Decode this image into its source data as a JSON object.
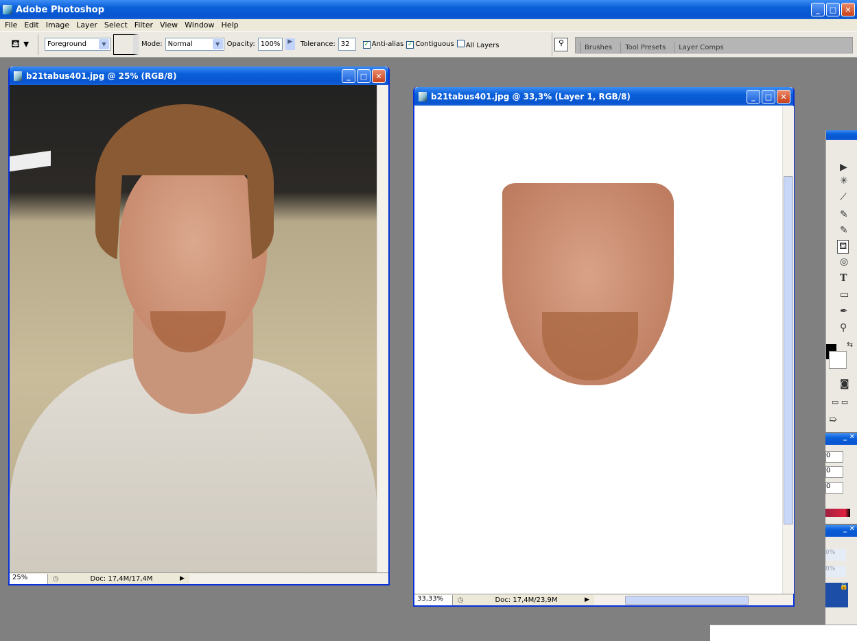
{
  "app": {
    "title": "Adobe Photoshop"
  },
  "menu": [
    "File",
    "Edit",
    "Image",
    "Layer",
    "Select",
    "Filter",
    "View",
    "Window",
    "Help"
  ],
  "options": {
    "fill_source": "Foreground",
    "mode_label": "Mode:",
    "mode": "Normal",
    "opacity_label": "Opacity:",
    "opacity": "100%",
    "tolerance_label": "Tolerance:",
    "tolerance": "32",
    "anti_alias": {
      "label": "Anti-alias",
      "checked": true
    },
    "contiguous": {
      "label": "Contiguous",
      "checked": true
    },
    "all_layers": {
      "label": "All Layers",
      "checked": false
    }
  },
  "palette_tabs": [
    "Brushes",
    "Tool Presets",
    "Layer Comps"
  ],
  "documents": [
    {
      "title": "b21tabus401.jpg @ 25% (RGB/8)",
      "zoom": "25%",
      "doc_info": "Doc: 17,4M/17,4M"
    },
    {
      "title": "b21tabus401.jpg @ 33,3% (Layer 1, RGB/8)",
      "zoom": "33,33%",
      "doc_info": "Doc: 17,4M/23,9M"
    }
  ],
  "panels": {
    "color_values": [
      "0",
      "0",
      "0"
    ],
    "layers_values": [
      "0%",
      "0%"
    ],
    "type_tool": "T"
  },
  "colors": {
    "titlebar": "#0a5fd8",
    "workspace": "#808080",
    "menu_bg": "#ece9d8"
  }
}
